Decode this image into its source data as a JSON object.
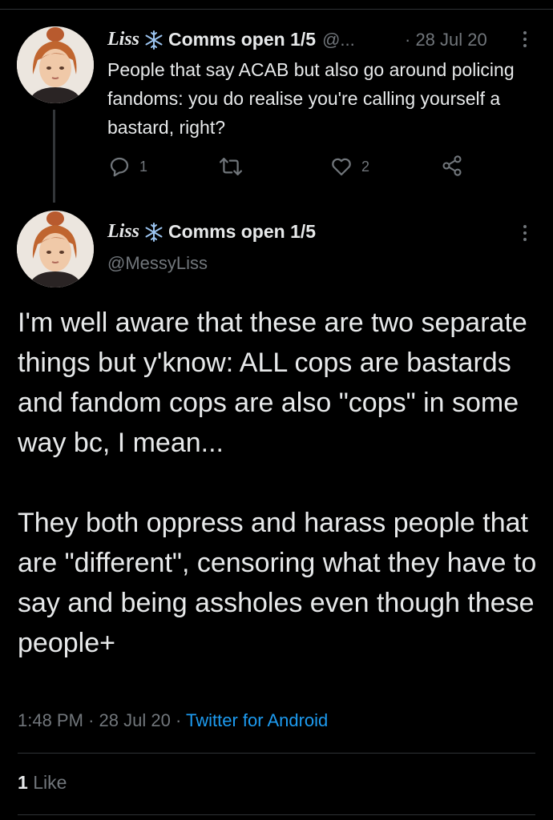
{
  "parent_tweet": {
    "display_name": "Liss",
    "name_suffix": "Comms open 1/5",
    "handle_truncated": "@...",
    "date": "· 28 Jul 20",
    "text": "People that say ACAB but also go around policing fandoms: you do realise you're calling yourself a bastard, right?",
    "reply_count": "1",
    "retweet_count": "",
    "like_count": "2"
  },
  "main_tweet": {
    "display_name": "Liss",
    "name_suffix": "Comms open 1/5",
    "handle": "@MessyLiss",
    "paragraphs": [
      "I'm well aware that these are two separate things but y'know: ALL cops are bastards and fandom cops are also \"cops\" in some way bc, I mean...",
      "They both oppress and harass people that are \"different\", censoring what they have to say and being assholes even though these people+"
    ],
    "time": "1:48 PM",
    "date": "28 Jul 20",
    "source": "Twitter for Android",
    "like_count": "1",
    "like_label": "Like"
  },
  "icons": {
    "snowflake": "snowflake-icon",
    "reply": "reply-icon",
    "retweet": "retweet-icon",
    "like": "heart-icon",
    "share": "share-icon",
    "more": "more-vertical-icon"
  },
  "colors": {
    "background": "#000000",
    "text": "#e7e9ea",
    "muted": "#71767b",
    "link": "#1d9bf0",
    "snowflake": "#9bc4f0"
  }
}
